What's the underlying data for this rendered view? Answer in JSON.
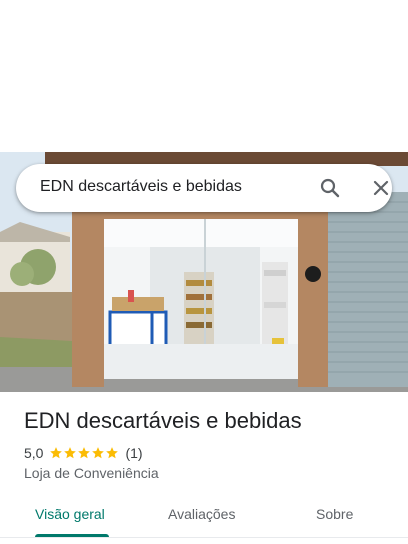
{
  "search": {
    "query": "EDN descartáveis e bebidas"
  },
  "place": {
    "name": "EDN descartáveis e bebidas",
    "rating": "5,0",
    "stars": 5,
    "review_count": "(1)",
    "category": "Loja de Conveniência"
  },
  "tabs": [
    {
      "label": "Visão geral",
      "active": true
    },
    {
      "label": "Avaliações",
      "active": false
    },
    {
      "label": "Sobre",
      "active": false
    }
  ],
  "colors": {
    "accent": "#00796b",
    "star": "#fbbc04"
  },
  "icons": {
    "search": "search-icon",
    "close": "close-icon"
  }
}
